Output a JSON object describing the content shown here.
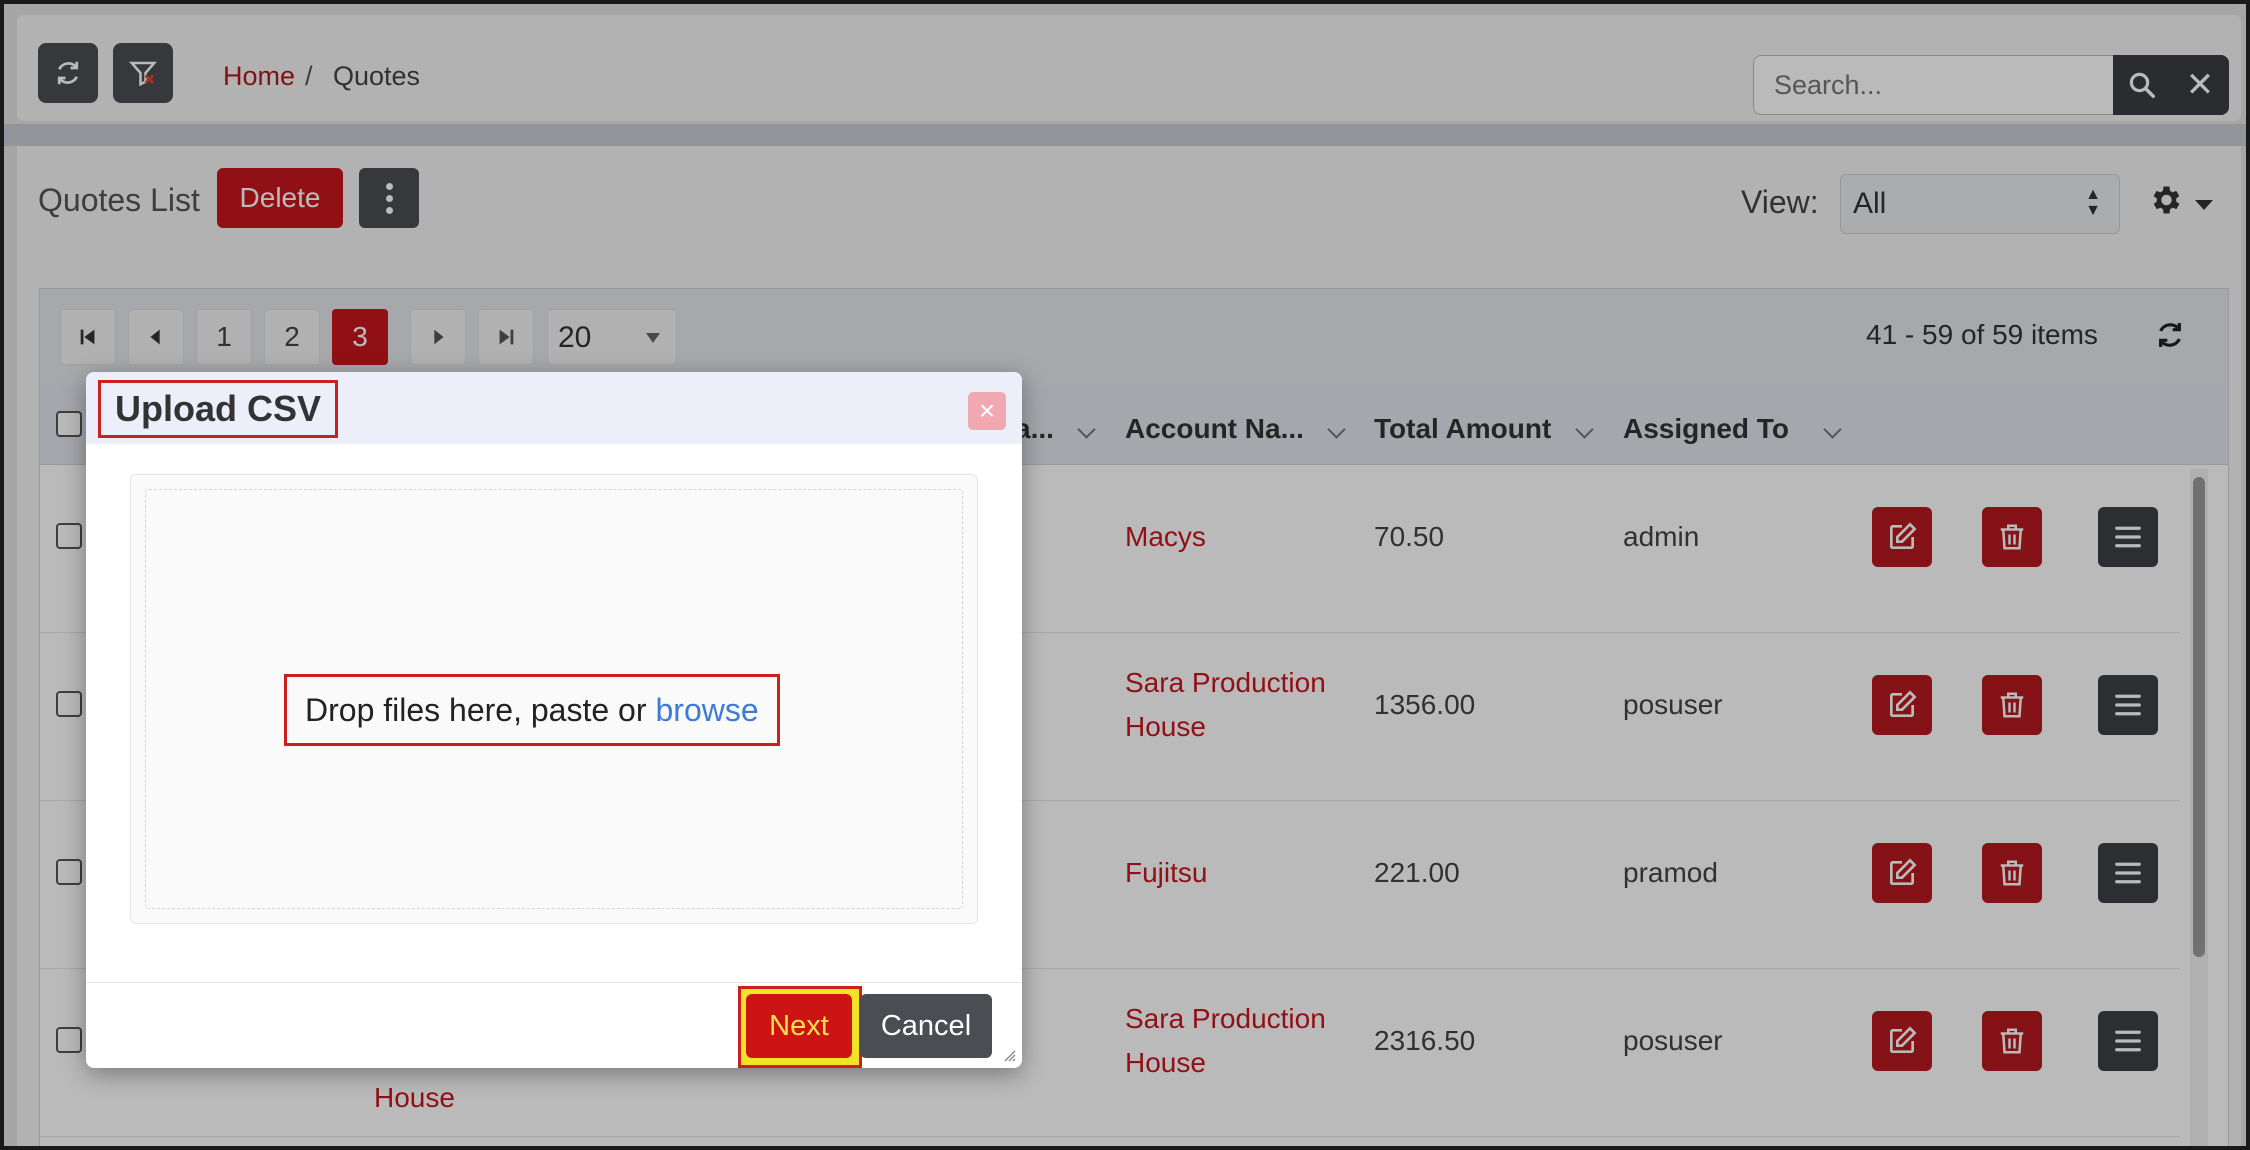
{
  "breadcrumb": {
    "home": "Home",
    "separator": "/",
    "current": "Quotes"
  },
  "search": {
    "placeholder": "Search...",
    "value": "",
    "clear_glyph": "✕"
  },
  "toolbar": {
    "title": "Quotes List",
    "delete_label": "Delete",
    "view_label": "View:",
    "view_value": "All"
  },
  "pagination": {
    "pages": [
      "1",
      "2",
      "3"
    ],
    "active_page": "3",
    "page_size": "20",
    "items_info": "41 - 59 of 59 items"
  },
  "table": {
    "columns": [
      "Account Na...",
      "Total Amount",
      "Assigned To"
    ],
    "partial_column": "a...",
    "rows": [
      {
        "account": [
          "Macys"
        ],
        "total": "70.50",
        "assigned": "admin"
      },
      {
        "account": [
          "Sara Production",
          "House"
        ],
        "total": "1356.00",
        "assigned": "posuser"
      },
      {
        "account": [
          "Fujitsu"
        ],
        "total": "221.00",
        "assigned": "pramod"
      },
      {
        "account": [
          "Sara Production",
          "House"
        ],
        "total": "2316.50",
        "assigned": "posuser"
      }
    ],
    "trailing_fragment": "House"
  },
  "modal": {
    "title": "Upload CSV",
    "close_glyph": "×",
    "drop_text": "Drop files here, paste or",
    "browse_label": "browse",
    "next_label": "Next",
    "cancel_label": "Cancel"
  },
  "colors": {
    "accent_red": "#c7171e",
    "dark_button": "#4a4d51",
    "link_blue": "#3d7bd6",
    "highlight_yellow": "#f2e22b"
  },
  "icons": [
    "refresh-icon",
    "filter-icon",
    "search-icon",
    "close-icon",
    "kebab-icon",
    "gear-icon",
    "first-page-icon",
    "prev-page-icon",
    "next-page-icon",
    "last-page-icon",
    "edit-icon",
    "trash-icon",
    "menu-icon"
  ]
}
